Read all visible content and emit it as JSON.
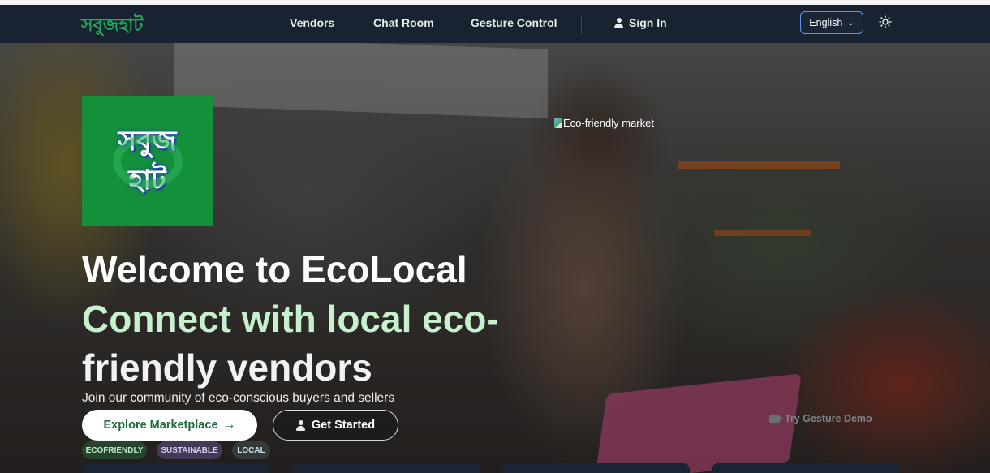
{
  "navbar": {
    "brand": "সবুজহাট",
    "links": [
      "Vendors",
      "Chat Room",
      "Gesture Control"
    ],
    "signin": "Sign In",
    "language": "English"
  },
  "hero": {
    "logo_line1": "সবুজ",
    "logo_line2": "হাট",
    "image_alt": "Eco-friendly market",
    "title": "Welcome to EcoLocal",
    "subtitle_green": "Connect with local eco-",
    "subtitle_rest": "friendly vendors",
    "tagline": "Join our community of eco-conscious buyers and sellers",
    "primary_button": "Explore Marketplace",
    "secondary_button": "Get Started",
    "gesture_demo": "Try Gesture Demo",
    "tags": [
      "ECOFRIENDLY",
      "SUSTAINABLE",
      "LOCAL"
    ]
  },
  "colors": {
    "navbar_bg": "#182230",
    "brand_green": "#22a55c",
    "logo_bg": "#15903a",
    "accent_light_green": "#c7f0cc",
    "language_border": "#5a9be0"
  }
}
